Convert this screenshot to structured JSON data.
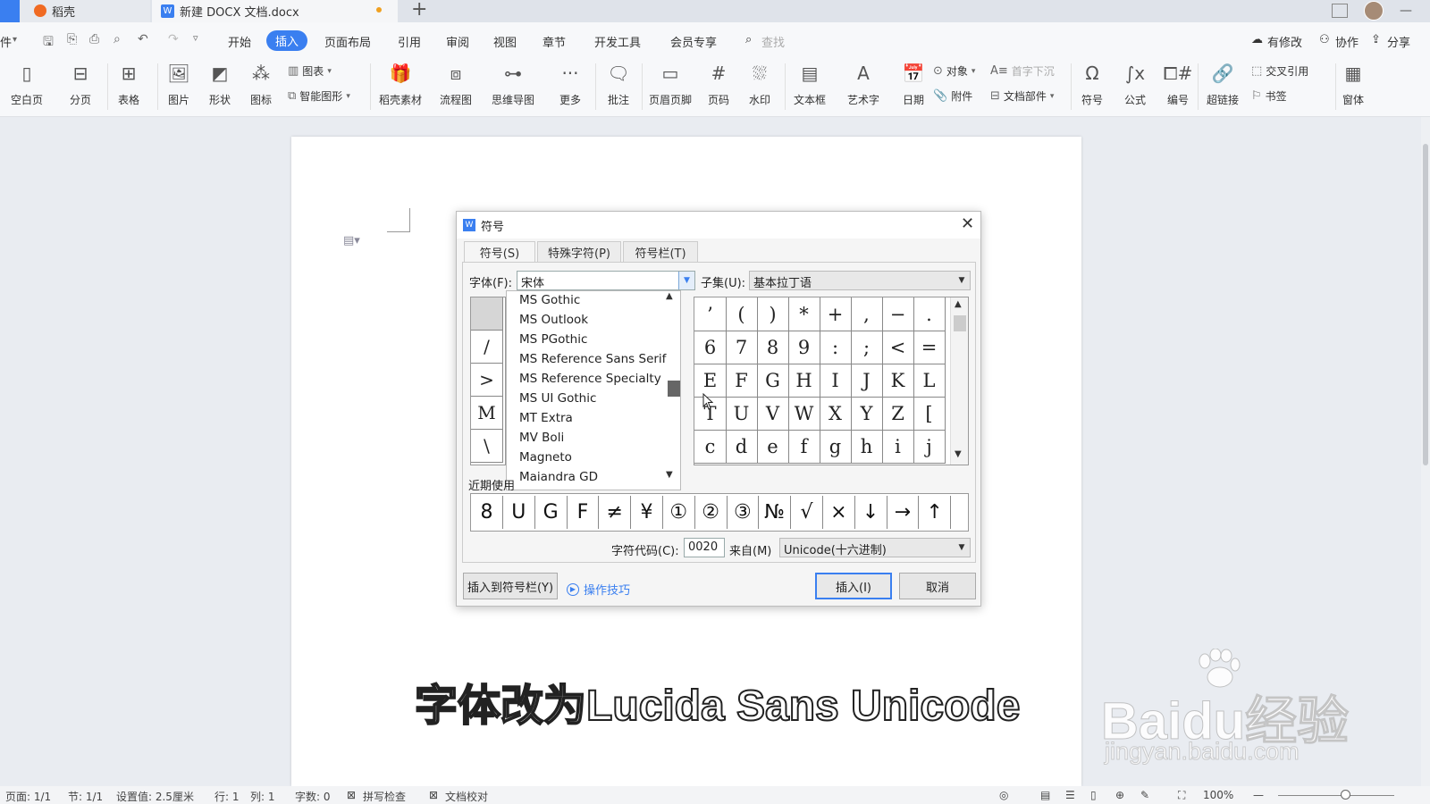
{
  "tabs": {
    "daoke": "稻壳",
    "doc": "新建 DOCX 文档.docx",
    "plus": "+"
  },
  "menu": {
    "file_partial": "件",
    "items": [
      "开始",
      "插入",
      "页面布局",
      "引用",
      "审阅",
      "视图",
      "章节",
      "开发工具",
      "会员专享"
    ],
    "active": "插入",
    "search": "查找",
    "right": [
      "有修改",
      "协作",
      "分享"
    ]
  },
  "ribbon": {
    "big": [
      "空白页",
      "分页",
      "表格",
      "图片",
      "形状",
      "图标",
      "稻壳素材",
      "流程图",
      "思维导图",
      "更多",
      "批注",
      "页眉页脚",
      "页码",
      "水印",
      "文本框",
      "艺术字",
      "日期",
      "符号",
      "公式",
      "编号",
      "超链接",
      "窗体"
    ],
    "small": {
      "chart": "图表",
      "smart": "智能图形",
      "object": "对象",
      "dropcap": "首字下沉",
      "attach": "附件",
      "docpart": "文档部件",
      "crossref": "交叉引用",
      "bookmark": "书签"
    }
  },
  "status": {
    "page": "页面: 1/1",
    "section": "节: 1/1",
    "setting": "设置值: 2.5厘米",
    "row": "行: 1",
    "col": "列: 1",
    "words": "字数: 0",
    "spell": "拼写检查",
    "proof": "文档校对",
    "zoom": "100%"
  },
  "dialog": {
    "logo": "W",
    "title": "符号",
    "tabs": [
      "符号(S)",
      "特殊字符(P)",
      "符号栏(T)"
    ],
    "font_label": "字体(F):",
    "font_value": "宋体",
    "subset_label": "子集(U):",
    "subset_value": "基本拉丁语",
    "font_list": [
      "MS Gothic",
      "MS Outlook",
      "MS PGothic",
      "MS Reference Sans Serif",
      "MS Reference Specialty",
      "MS UI Gothic",
      "MT Extra",
      "MV Boli",
      "Magneto",
      "Maiandra GD"
    ],
    "left_symbols": [
      "",
      "/",
      ">",
      "M",
      "\\"
    ],
    "symbols": [
      "’",
      "(",
      ")",
      "*",
      "+",
      ",",
      "−",
      ".",
      "6",
      "7",
      "8",
      "9",
      ":",
      ";",
      "<",
      "=",
      "E",
      "F",
      "G",
      "H",
      "I",
      "J",
      "K",
      "L",
      "T",
      "U",
      "V",
      "W",
      "X",
      "Y",
      "Z",
      "[",
      "c",
      "d",
      "e",
      "f",
      "g",
      "h",
      "i",
      "j"
    ],
    "recent_label": "近期使用",
    "recent": [
      "8",
      "U",
      "G",
      "F",
      "≠",
      "¥",
      "①",
      "②",
      "③",
      "№",
      "√",
      "×",
      "↓",
      "→",
      "↑"
    ],
    "code_label": "字符代码(C):",
    "code_value": "0020",
    "from_label": "来自(M)",
    "from_value": "Unicode(十六进制)",
    "insert_bar": "插入到符号栏(Y)",
    "tips": "操作技巧",
    "insert": "插入(I)",
    "cancel": "取消"
  },
  "caption": "字体改为Lucida Sans Unicode",
  "watermark": {
    "brand": "Baidu经验",
    "url": "jingyan.baidu.com"
  }
}
